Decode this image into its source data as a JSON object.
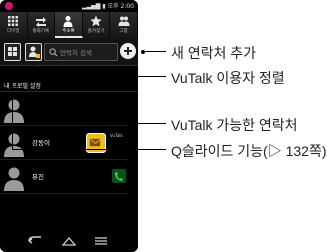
{
  "status_bar": {
    "clock": "오후 2:00"
  },
  "app_tabs": [
    {
      "label": "다이얼",
      "icon": "dialpad-icon",
      "active": false
    },
    {
      "label": "통화기록",
      "icon": "call-log-icon",
      "active": false
    },
    {
      "label": "주소록",
      "icon": "contacts-icon",
      "active": true
    },
    {
      "label": "즐겨찾기",
      "icon": "star-icon",
      "active": false
    },
    {
      "label": "그룹",
      "icon": "group-icon",
      "active": false
    }
  ],
  "toolbar": {
    "search_placeholder": "연락처 검색"
  },
  "profile_section": {
    "label": "내 프로필 설정"
  },
  "contacts": [
    {
      "name": "",
      "avatar": "person-silhouette-icon"
    },
    {
      "name": "강동이",
      "avatar": "person-silhouette-icon",
      "vutalk_tag": "VuTalk"
    },
    {
      "name": "뮤진",
      "avatar": "person-silhouette-icon"
    }
  ],
  "callouts": {
    "new_contact": "새 연락처 추가",
    "vutalk_sort": "VuTalk 이용자 정렬",
    "vutalk_contact": "VuTalk 가능한 연락처",
    "qslide": "Q슬라이드 기능(▷ 132쪽)"
  },
  "colors": {
    "vutalk_button": "#f4bb1f",
    "qslide_button": "#0d4f18",
    "status_logo": "#d3126b"
  }
}
